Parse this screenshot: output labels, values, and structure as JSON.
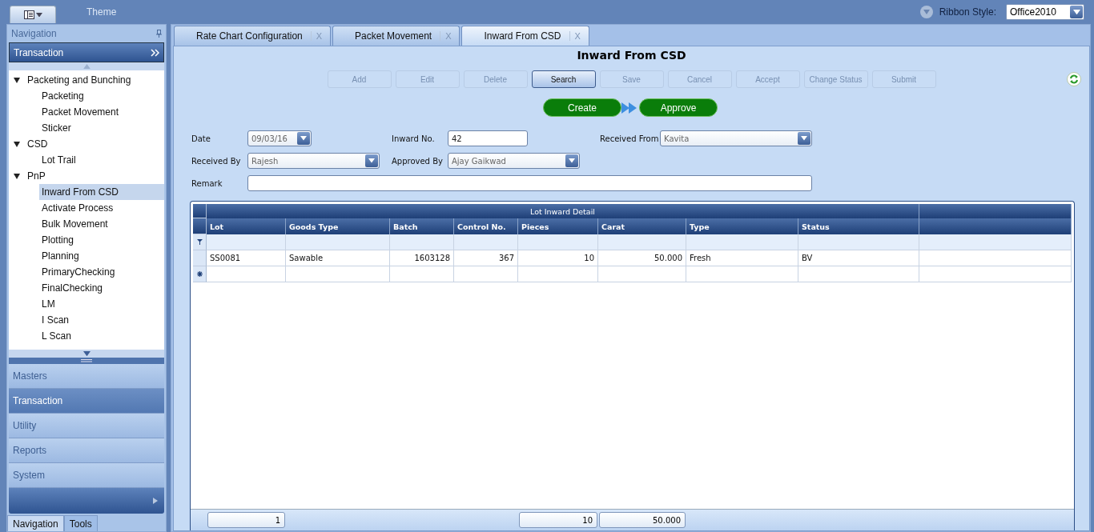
{
  "top_bar": {
    "theme_label": "Theme",
    "ribbon_style": {
      "label": "Ribbon Style:",
      "value": "Office2010"
    }
  },
  "navigation": {
    "title": "Navigation",
    "group_header": "Transaction",
    "tree": [
      {
        "label": "Packeting and Bunching",
        "expanded": true,
        "children": [
          {
            "label": "Packeting",
            "selected": false
          },
          {
            "label": "Packet Movement",
            "selected": false
          },
          {
            "label": "Sticker",
            "selected": false
          }
        ]
      },
      {
        "label": "CSD",
        "expanded": true,
        "children": [
          {
            "label": "Lot Trail",
            "selected": false
          }
        ]
      },
      {
        "label": "PnP",
        "expanded": true,
        "children": [
          {
            "label": "Inward From CSD",
            "selected": true
          },
          {
            "label": "Activate Process",
            "selected": false
          },
          {
            "label": "Bulk Movement",
            "selected": false
          },
          {
            "label": "Plotting",
            "selected": false
          },
          {
            "label": "Planning",
            "selected": false
          },
          {
            "label": "PrimaryChecking",
            "selected": false
          },
          {
            "label": "FinalChecking",
            "selected": false
          },
          {
            "label": "LM",
            "selected": false
          },
          {
            "label": "I Scan",
            "selected": false
          },
          {
            "label": "L Scan",
            "selected": false
          }
        ]
      }
    ],
    "sections": [
      {
        "label": "Masters",
        "selected": false
      },
      {
        "label": "Transaction",
        "selected": true
      },
      {
        "label": "Utility",
        "selected": false
      },
      {
        "label": "Reports",
        "selected": false
      },
      {
        "label": "System",
        "selected": false
      }
    ],
    "bottom_tabs": [
      {
        "label": "Navigation",
        "selected": true
      },
      {
        "label": "Tools",
        "selected": false
      }
    ]
  },
  "tabs": [
    {
      "label": "Rate Chart Configuration",
      "close": "X",
      "selected": false
    },
    {
      "label": "Packet Movement",
      "close": "X",
      "selected": false
    },
    {
      "label": "Inward From CSD",
      "close": "X",
      "selected": true
    }
  ],
  "form": {
    "title": "Inward From CSD",
    "toolbar": [
      {
        "label": "Add",
        "disabled": true
      },
      {
        "label": "Edit",
        "disabled": true
      },
      {
        "label": "Delete",
        "disabled": true
      },
      {
        "label": "Search",
        "disabled": false
      },
      {
        "label": "Save",
        "disabled": true
      },
      {
        "label": "Cancel",
        "disabled": true
      },
      {
        "label": "Accept",
        "disabled": true
      },
      {
        "label": "Change Status",
        "disabled": true
      },
      {
        "label": "Submit",
        "disabled": true
      }
    ],
    "workflow": [
      "Create",
      "Approve"
    ],
    "field_rows": [
      [
        {
          "kind": "date",
          "label": "Date",
          "value": "09/03/16"
        },
        {
          "kind": "text",
          "label": "Inward No.",
          "value": "42"
        },
        {
          "kind": "dropdown",
          "label": "Received From",
          "value": "Kavita"
        }
      ],
      [
        {
          "kind": "dropdown",
          "label": "Received By",
          "value": "Rajesh"
        },
        {
          "kind": "dropdown",
          "label": "Approved By",
          "value": "Ajay Gaikwad"
        }
      ]
    ],
    "remark": {
      "label": "Remark"
    }
  },
  "grid": {
    "title": "Lot Inward Detail",
    "columns": [
      {
        "label": "Lot",
        "kind": "text",
        "total": "1"
      },
      {
        "label": "Goods Type",
        "kind": "text"
      },
      {
        "label": "Batch",
        "kind": "number"
      },
      {
        "label": "Control No.",
        "kind": "number"
      },
      {
        "label": "Pieces",
        "kind": "number",
        "total": "10"
      },
      {
        "label": "Carat",
        "kind": "number",
        "total": "50.000"
      },
      {
        "label": "Type",
        "kind": "text"
      },
      {
        "label": "Status",
        "kind": "text"
      }
    ],
    "rows": [
      [
        "SS0081",
        "Sawable",
        "1603128",
        "367",
        "10",
        "50.000",
        "Fresh",
        "BV"
      ]
    ]
  }
}
